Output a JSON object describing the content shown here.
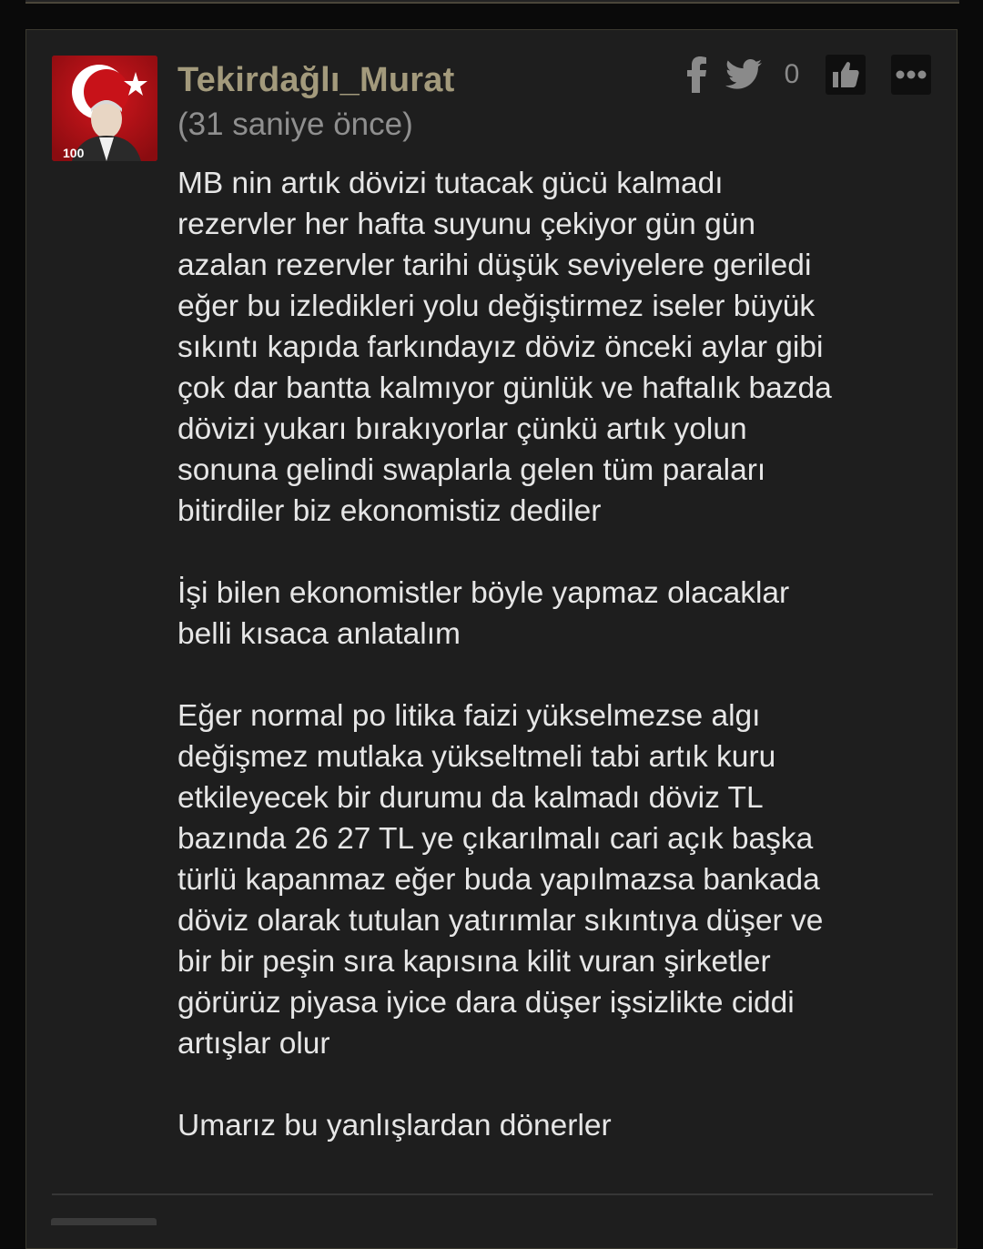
{
  "comment": {
    "author": "Tekirdağlı_Murat",
    "timestamp": "(31 saniye önce)",
    "like_count": "0",
    "paragraphs": [
      "MB nin artık dövizi tutacak gücü kalmadı\nrezervler her hafta suyunu çekiyor gün gün\nazalan rezervler tarihi düşük seviyelere geriledi\neğer bu izledikleri yolu değiştirmez iseler büyük\nsıkıntı kapıda farkındayız döviz önceki aylar gibi\nçok dar bantta kalmıyor günlük ve haftalık bazda\ndövizi yukarı bırakıyorlar çünkü artık yolun\nsonuna gelindi swaplarla gelen tüm paraları\nbitirdiler biz ekonomistiz dediler",
      "İşi bilen ekonomistler böyle yapmaz olacaklar\nbelli kısaca anlatalım",
      "Eğer normal po litika faizi yükselmezse algı\ndeğişmez mutlaka yükseltmeli tabi artık kuru\netkileyecek bir durumu da kalmadı döviz TL\nbazında 26 27 TL ye çıkarılmalı cari açık başka\ntürlü kapanmaz eğer buda yapılmazsa bankada\ndöviz olarak tutulan yatırımlar sıkıntıya düşer ve\nbir bir peşin sıra kapısına kilit vuran şirketler\ngörürüz piyasa iyice dara düşer işsizlikte ciddi\nartışlar olur",
      "Umarız bu yanlışlardan dönerler"
    ],
    "avatar_badge": "100",
    "icons": {
      "share_facebook": "facebook-icon",
      "share_twitter": "twitter-icon",
      "like": "thumbs-up-icon",
      "more": "more-dots-icon"
    }
  },
  "colors": {
    "background": "#0a0a0a",
    "card": "#1e1e1e",
    "username": "#a39a7c",
    "timestamp": "#8f8f8f",
    "body_text": "#e6e6e6",
    "avatar_red": "#b10f14"
  }
}
